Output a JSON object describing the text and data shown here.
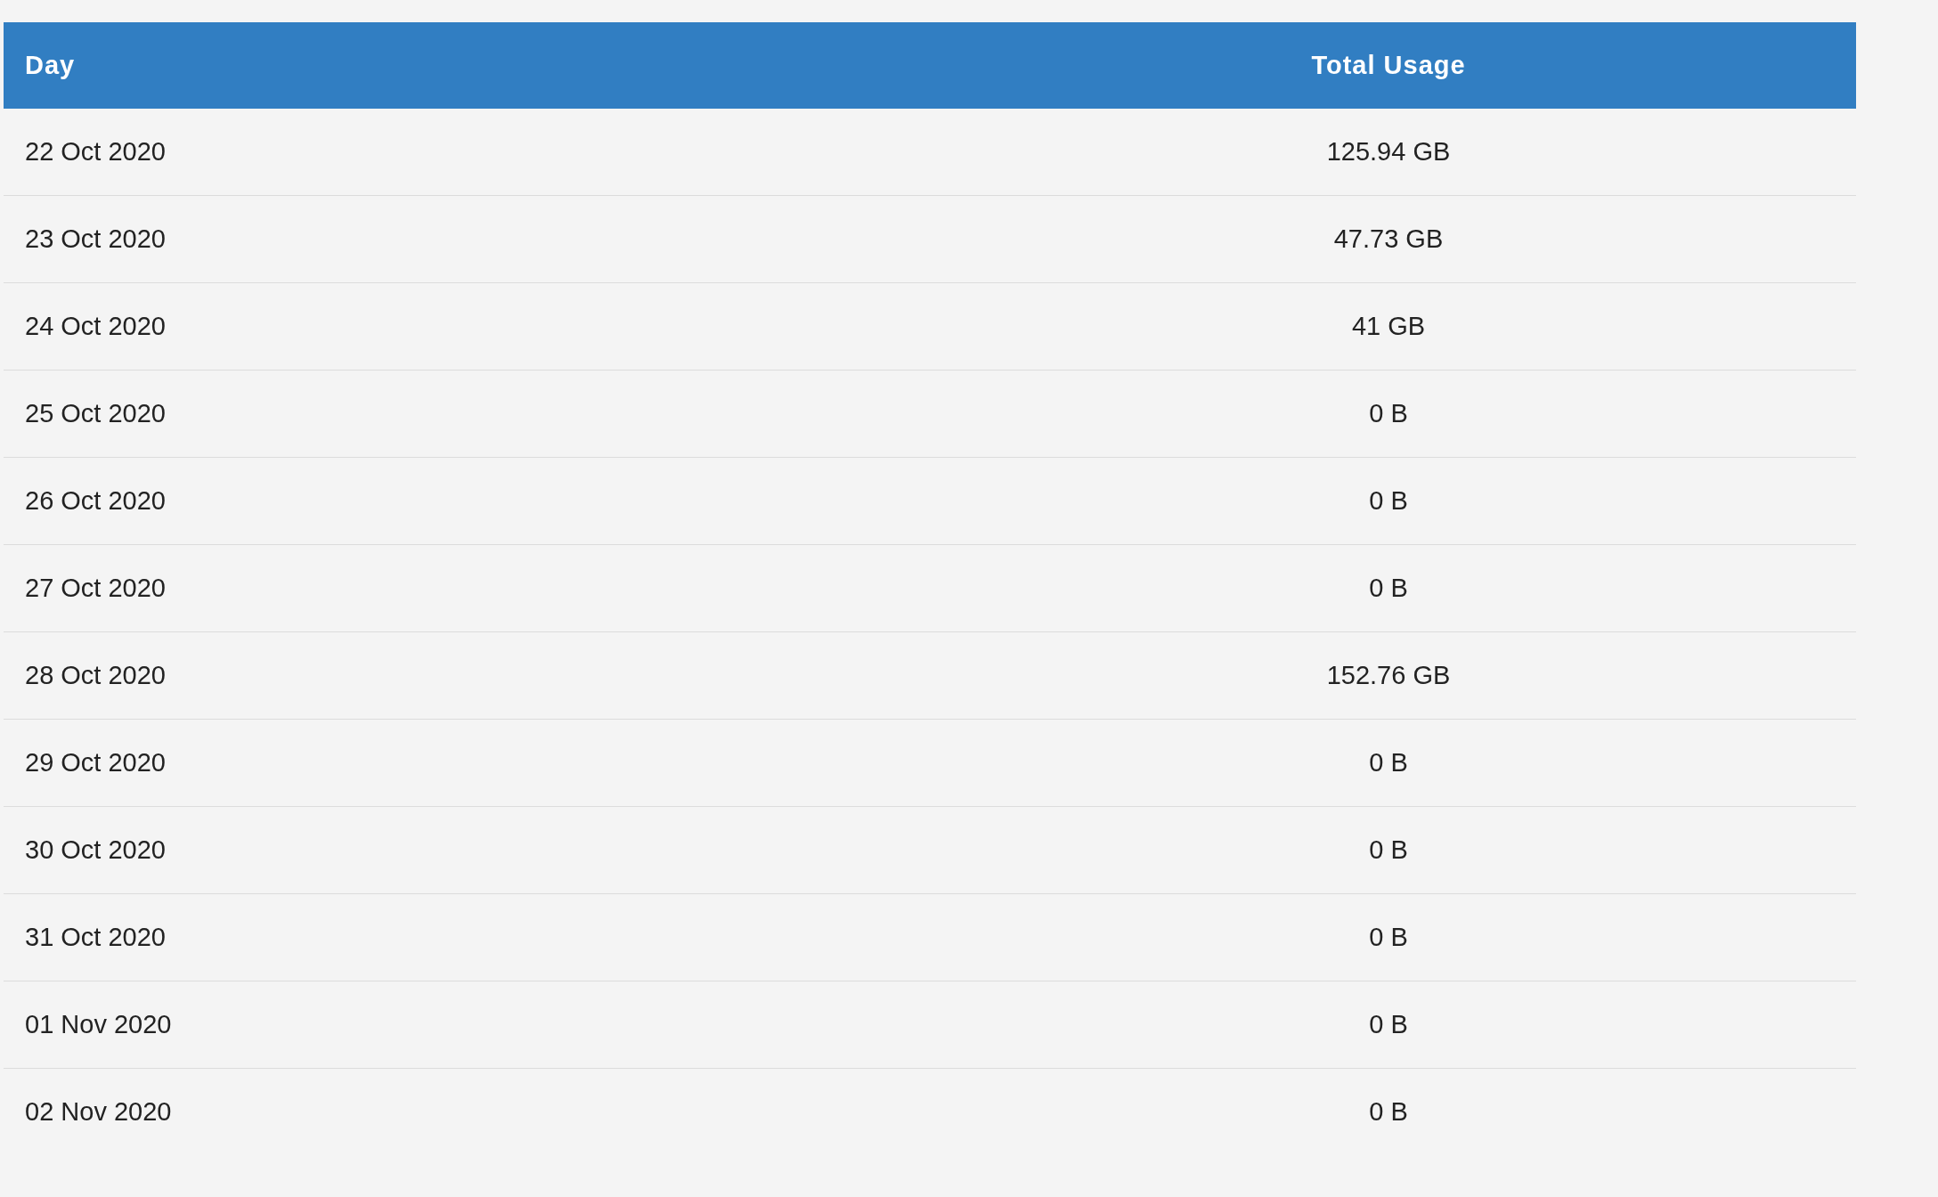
{
  "table": {
    "columns": [
      "Day",
      "Total Usage"
    ],
    "rows": [
      [
        "22 Oct 2020",
        "125.94 GB"
      ],
      [
        "23 Oct 2020",
        "47.73 GB"
      ],
      [
        "24 Oct 2020",
        "41 GB"
      ],
      [
        "25 Oct 2020",
        "0 B"
      ],
      [
        "26 Oct 2020",
        "0 B"
      ],
      [
        "27 Oct 2020",
        "0 B"
      ],
      [
        "28 Oct 2020",
        "152.76 GB"
      ],
      [
        "29 Oct 2020",
        "0 B"
      ],
      [
        "30 Oct 2020",
        "0 B"
      ],
      [
        "31 Oct 2020",
        "0 B"
      ],
      [
        "01 Nov 2020",
        "0 B"
      ],
      [
        "02 Nov 2020",
        "0 B"
      ]
    ]
  }
}
